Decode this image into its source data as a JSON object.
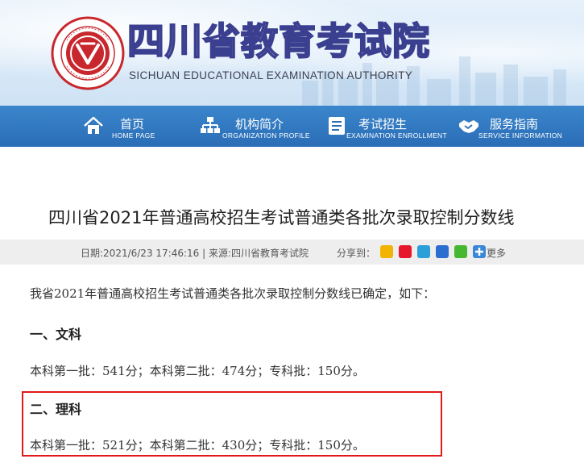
{
  "header": {
    "site_title": "四川省教育考试院",
    "site_title_en": "SICHUAN EDUCATIONAL EXAMINATION AUTHORITY"
  },
  "nav": {
    "items": [
      {
        "label": "首页",
        "sub": "HOME PAGE",
        "icon": "home-icon"
      },
      {
        "label": "机构简介",
        "sub": "ORGANIZATION PROFILE",
        "icon": "org-chart-icon"
      },
      {
        "label": "考试招生",
        "sub": "EXAMINATION ENROLLMENT",
        "icon": "document-list-icon"
      },
      {
        "label": "服务指南",
        "sub": "SERVICE INFORMATION",
        "icon": "handshake-icon"
      }
    ]
  },
  "article": {
    "title": "四川省2021年普通高校招生考试普通类各批次录取控制分数线",
    "meta": "日期:2021/6/23 17:46:16 | 来源:四川省教育考试院",
    "share_label": "分享到：",
    "share_more": "更多",
    "intro": "我省2021年普通高校招生考试普通类各批次录取控制分数线已确定，如下：",
    "section1_head": "一、文科",
    "section1_body": "本科第一批：541分；本科第二批：474分；专科批：150分。",
    "section2_head": "二、理科",
    "section2_body": "本科第一批：521分；本科第二批：430分；专科批：150分。"
  },
  "colors": {
    "nav_bg": "#2a6db6",
    "highlight_border": "#e01a1a",
    "title_stroke": "#3b3f8f",
    "logo_red": "#c8282d"
  }
}
